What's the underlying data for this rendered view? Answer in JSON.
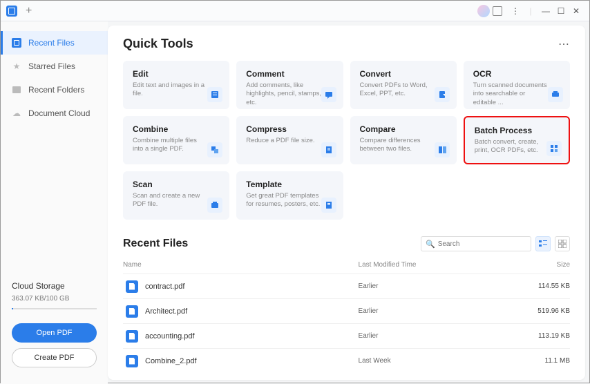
{
  "sidebar": {
    "items": [
      {
        "label": "Recent Files"
      },
      {
        "label": "Starred Files"
      },
      {
        "label": "Recent Folders"
      },
      {
        "label": "Document Cloud"
      }
    ],
    "storage_title": "Cloud Storage",
    "storage_usage": "363.07 KB/100 GB",
    "open_btn": "Open PDF",
    "create_btn": "Create PDF"
  },
  "main": {
    "quick_tools_title": "Quick Tools",
    "tools": [
      {
        "title": "Edit",
        "desc": "Edit text and images in a file."
      },
      {
        "title": "Comment",
        "desc": "Add comments, like highlights, pencil, stamps, etc."
      },
      {
        "title": "Convert",
        "desc": "Convert PDFs to Word, Excel, PPT, etc."
      },
      {
        "title": "OCR",
        "desc": "Turn scanned documents into searchable or editable ..."
      },
      {
        "title": "Combine",
        "desc": "Combine multiple files into a single PDF."
      },
      {
        "title": "Compress",
        "desc": "Reduce a PDF file size."
      },
      {
        "title": "Compare",
        "desc": "Compare differences between two files."
      },
      {
        "title": "Batch Process",
        "desc": "Batch convert, create, print, OCR PDFs, etc."
      },
      {
        "title": "Scan",
        "desc": "Scan and create a new PDF file."
      },
      {
        "title": "Template",
        "desc": "Get great PDF templates for resumes, posters, etc."
      }
    ],
    "recent_title": "Recent Files",
    "search_placeholder": "Search",
    "cols": {
      "name": "Name",
      "time": "Last Modified Time",
      "size": "Size"
    },
    "files": [
      {
        "name": "contract.pdf",
        "time": "Earlier",
        "size": "114.55 KB"
      },
      {
        "name": "Architect.pdf",
        "time": "Earlier",
        "size": "519.96 KB"
      },
      {
        "name": "accounting.pdf",
        "time": "Earlier",
        "size": "113.19 KB"
      },
      {
        "name": "Combine_2.pdf",
        "time": "Last Week",
        "size": "11.1 MB"
      }
    ]
  }
}
